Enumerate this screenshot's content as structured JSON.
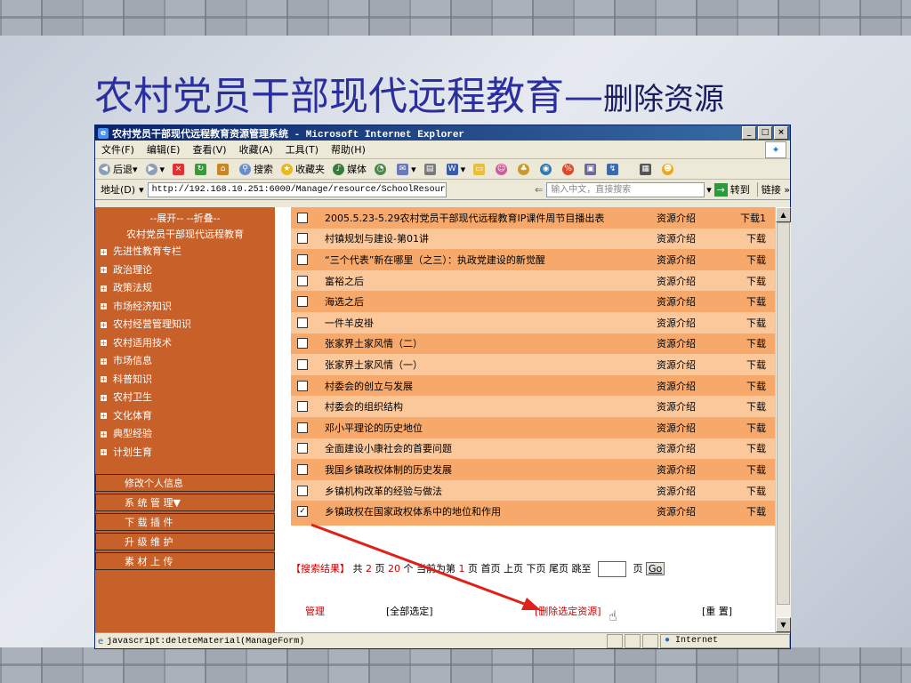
{
  "slide": {
    "title_main": "农村党员干部现代远程教育",
    "title_dash": "—",
    "title_sub": "删除资源"
  },
  "window": {
    "title": "农村党员干部现代远程教育资源管理系统 - Microsoft Internet Explorer",
    "minimize": "_",
    "maximize": "□",
    "close": "×"
  },
  "menubar": {
    "items": [
      "文件(F)",
      "编辑(E)",
      "查看(V)",
      "收藏(A)",
      "工具(T)",
      "帮助(H)"
    ]
  },
  "toolbar": {
    "back": "后退",
    "search": "搜索",
    "favorites": "收藏夹",
    "media": "媒体"
  },
  "address": {
    "label": "地址(D)",
    "url": "http://192.168.10.251:6000/Manage/resource/SchoolResource.asp",
    "search_hint": "输入中文，直接搜索",
    "go": "转到",
    "links": "链接"
  },
  "sidebar": {
    "expand_collapse": "--展开--  --折叠--",
    "root": "农村党员干部现代远程教育",
    "categories": [
      "先进性教育专栏",
      "政治理论",
      "政策法规",
      "市场经济知识",
      "农村经营管理知识",
      "农村适用技术",
      "市场信息",
      "科普知识",
      "农村卫生",
      "文化体育",
      "典型经验",
      "计划生育"
    ],
    "menu": [
      "修改个人信息",
      "系 统 管 理▼",
      "下 载 插 件",
      "升 级 维 护",
      "素 材 上 传"
    ]
  },
  "resources": [
    {
      "name": "2005.5.23-5.29农村党员干部现代远程教育IP课件周节目播出表",
      "intro": "资源介绍",
      "download": "下载1",
      "checked": false
    },
    {
      "name": "村镇规划与建设-第01讲",
      "intro": "资源介绍",
      "download": "下载",
      "checked": false
    },
    {
      "name": "“三个代表”新在哪里（之三）：执政党建设的新觉醒",
      "intro": "资源介绍",
      "download": "下载",
      "checked": false
    },
    {
      "name": "富裕之后",
      "intro": "资源介绍",
      "download": "下载",
      "checked": false
    },
    {
      "name": "海选之后",
      "intro": "资源介绍",
      "download": "下载",
      "checked": false
    },
    {
      "name": "一件羊皮褂",
      "intro": "资源介绍",
      "download": "下载",
      "checked": false
    },
    {
      "name": "张家界土家风情（二）",
      "intro": "资源介绍",
      "download": "下载",
      "checked": false
    },
    {
      "name": "张家界土家风情（一）",
      "intro": "资源介绍",
      "download": "下载",
      "checked": false
    },
    {
      "name": "村委会的创立与发展",
      "intro": "资源介绍",
      "download": "下载",
      "checked": false
    },
    {
      "name": "村委会的组织结构",
      "intro": "资源介绍",
      "download": "下载",
      "checked": false
    },
    {
      "name": "邓小平理论的历史地位",
      "intro": "资源介绍",
      "download": "下载",
      "checked": false
    },
    {
      "name": "全面建设小康社会的首要问题",
      "intro": "资源介绍",
      "download": "下载",
      "checked": false
    },
    {
      "name": "我国乡镇政权体制的历史发展",
      "intro": "资源介绍",
      "download": "下载",
      "checked": false
    },
    {
      "name": "乡镇机构改革的经验与做法",
      "intro": "资源介绍",
      "download": "下载",
      "checked": false
    },
    {
      "name": "乡镇政权在国家政权体系中的地位和作用",
      "intro": "资源介绍",
      "download": "下载",
      "checked": true
    }
  ],
  "pager": {
    "label": "【搜索结果】",
    "total_prefix": "共",
    "total_pages": "2",
    "page_unit": "页",
    "per_page": "20",
    "per_unit": "个",
    "current_prefix": "当前为第",
    "current": "1",
    "first": "首页",
    "prev": "上页",
    "next": "下页",
    "last": "尾页",
    "jump": "跳至",
    "go": "Go"
  },
  "actions": {
    "manage": "管理",
    "select_all": "[全部选定]",
    "delete": "[删除选定资源]",
    "reset": "[重 置]"
  },
  "status": {
    "text": "javascript:deleteMaterial(ManageForm)",
    "zone": "Internet"
  },
  "colors": {
    "sidebar": "#c8602a",
    "row_odd": "#f6a96a",
    "row_even": "#fbc89c",
    "title": "#2b2f9e",
    "arrow": "#e0201a"
  }
}
